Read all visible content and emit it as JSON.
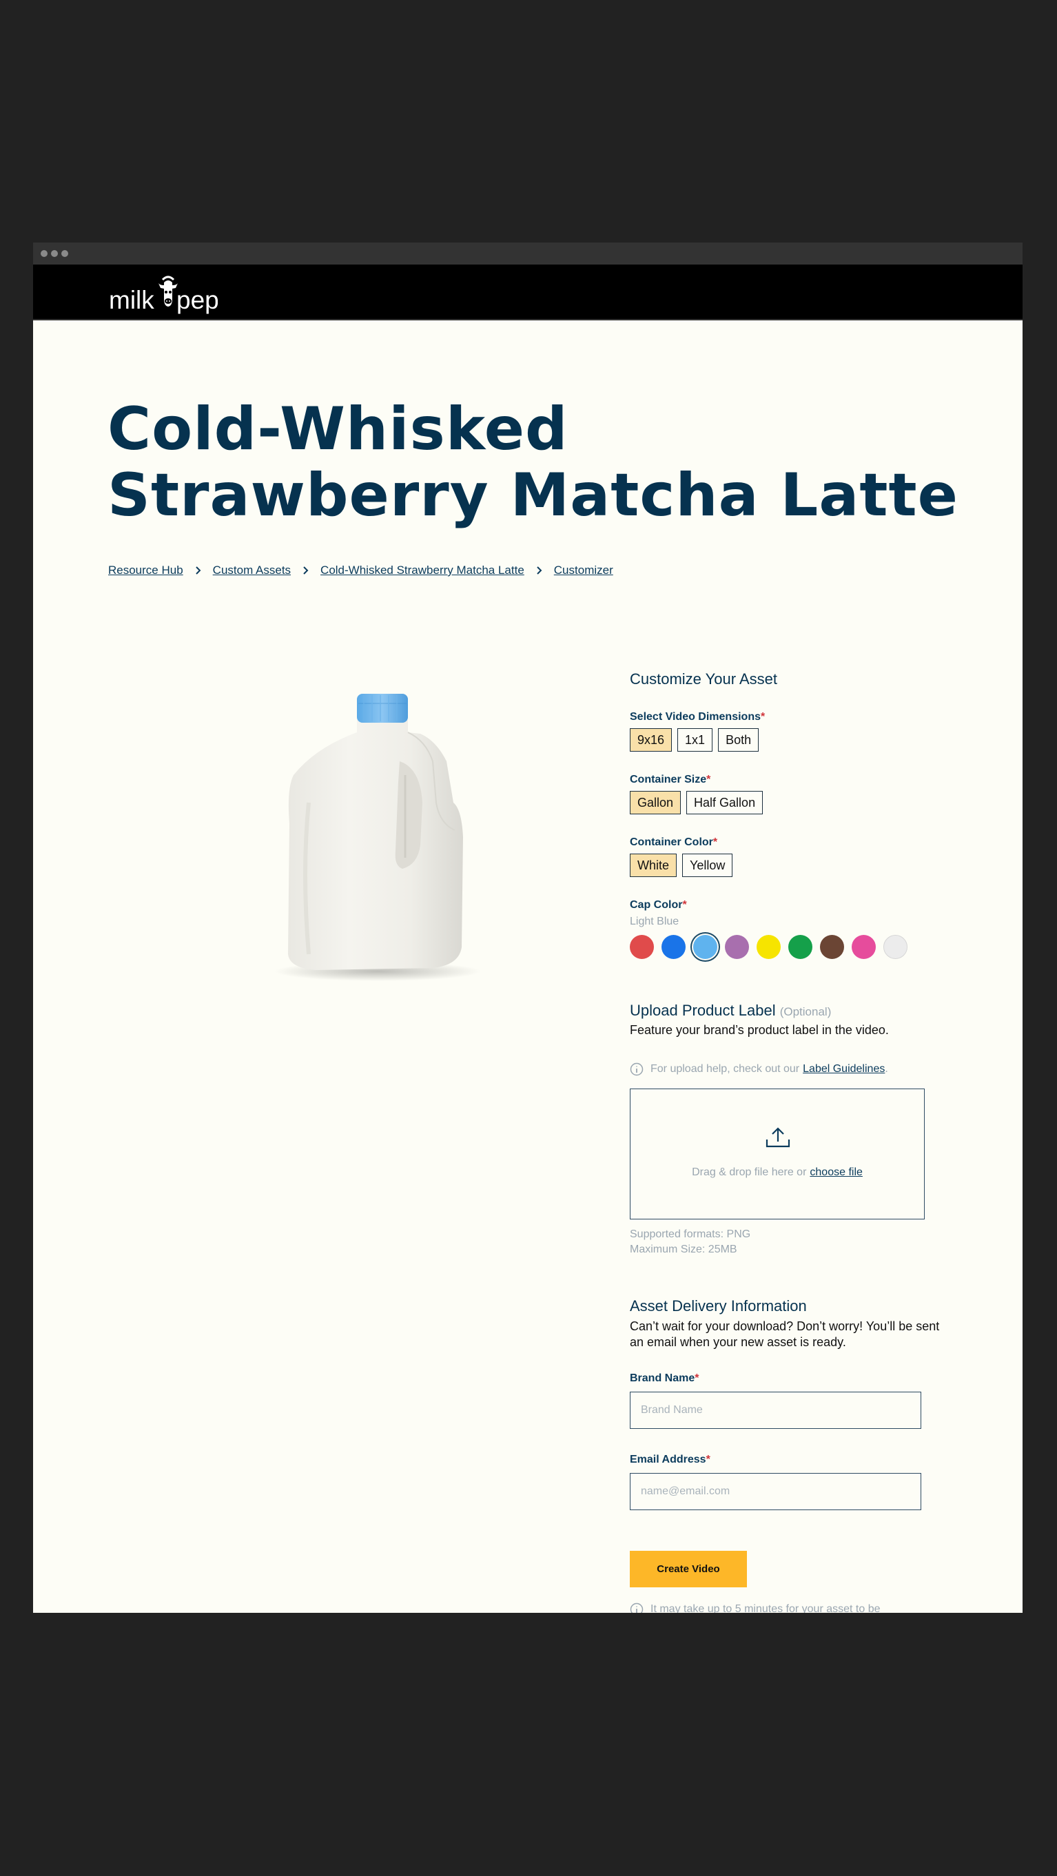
{
  "header": {
    "logo_text": "milk pep"
  },
  "page": {
    "title": "Cold-Whisked Strawberry Matcha Latte"
  },
  "breadcrumbs": [
    "Resource Hub",
    "Custom Assets",
    "Cold-Whisked Strawberry Matcha Latte",
    "Customizer"
  ],
  "product_image": {
    "icon": "milk-jug-image",
    "cap_color": "#5aa9e6"
  },
  "customize": {
    "heading": "Customize Your Asset",
    "video_dimensions": {
      "label": "Select Video Dimensions",
      "options": [
        "9x16",
        "1x1",
        "Both"
      ],
      "selected": "9x16"
    },
    "container_size": {
      "label": "Container Size",
      "options": [
        "Gallon",
        "Half Gallon"
      ],
      "selected": "Gallon"
    },
    "container_color": {
      "label": "Container Color",
      "options": [
        "White",
        "Yellow"
      ],
      "selected": "White"
    },
    "cap_color": {
      "label": "Cap Color",
      "selected_name": "Light Blue",
      "swatches": [
        "#e04b4b",
        "#1a74e8",
        "#5fb3ee",
        "#a86fae",
        "#f6e400",
        "#15a04a",
        "#6b4534",
        "#e64c9c",
        "#ececec"
      ],
      "selected_index": 2
    }
  },
  "upload": {
    "heading": "Upload Product Label",
    "optional": "(Optional)",
    "description": "Feature your brand’s product label in the video.",
    "help_text": "For upload help, check out our",
    "help_link": "Label Guidelines",
    "help_suffix": ".",
    "drop_text": "Drag & drop file here or",
    "choose_file": "choose file",
    "formats": "Supported formats: PNG",
    "max_size": "Maximum Size: 25MB"
  },
  "delivery": {
    "heading": "Asset Delivery Information",
    "description": "Can’t wait for your download? Don’t worry! You’ll be sent an email when your new asset is ready.",
    "brand_label": "Brand Name",
    "brand_placeholder": "Brand Name",
    "email_label": "Email Address",
    "email_placeholder": "name@email.com",
    "create_button": "Create Video",
    "note": "It may take up to 5 minutes for your asset to be"
  },
  "colors": {
    "navy": "#06324f",
    "accent": "#fdb728",
    "selected_bg": "#f9e0a9",
    "page_bg": "#fdfdf6"
  }
}
